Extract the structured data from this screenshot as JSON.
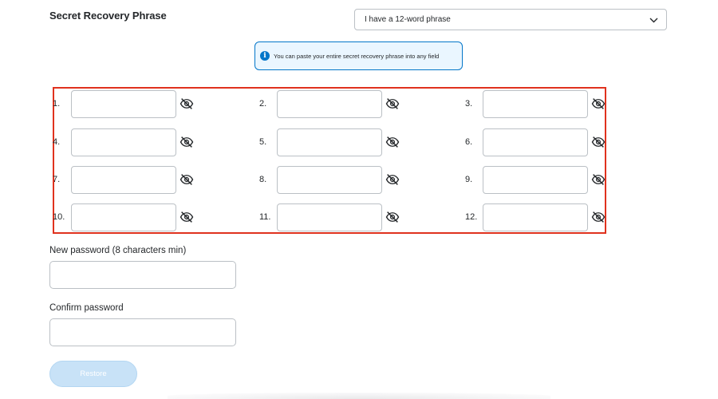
{
  "header": {
    "title": "Secret Recovery Phrase"
  },
  "phrase_select": {
    "selected": "I have a 12-word phrase"
  },
  "info_banner": {
    "icon": "info-icon",
    "text": "You can paste your entire secret recovery phrase into any field"
  },
  "words": [
    {
      "label": "1.",
      "value": ""
    },
    {
      "label": "2.",
      "value": ""
    },
    {
      "label": "3.",
      "value": ""
    },
    {
      "label": "4.",
      "value": ""
    },
    {
      "label": "5.",
      "value": ""
    },
    {
      "label": "6.",
      "value": ""
    },
    {
      "label": "7.",
      "value": ""
    },
    {
      "label": "8.",
      "value": ""
    },
    {
      "label": "9.",
      "value": ""
    },
    {
      "label": "10.",
      "value": ""
    },
    {
      "label": "11.",
      "value": ""
    },
    {
      "label": "12.",
      "value": ""
    }
  ],
  "word_visibility_icon": "eye-slash-icon",
  "highlight_color": "#e0321e",
  "new_password": {
    "label": "New password (8 characters min)",
    "value": ""
  },
  "confirm_password": {
    "label": "Confirm password",
    "value": ""
  },
  "restore_button": {
    "label": "Restore",
    "state": "disabled",
    "color": "#c8e2f7"
  }
}
